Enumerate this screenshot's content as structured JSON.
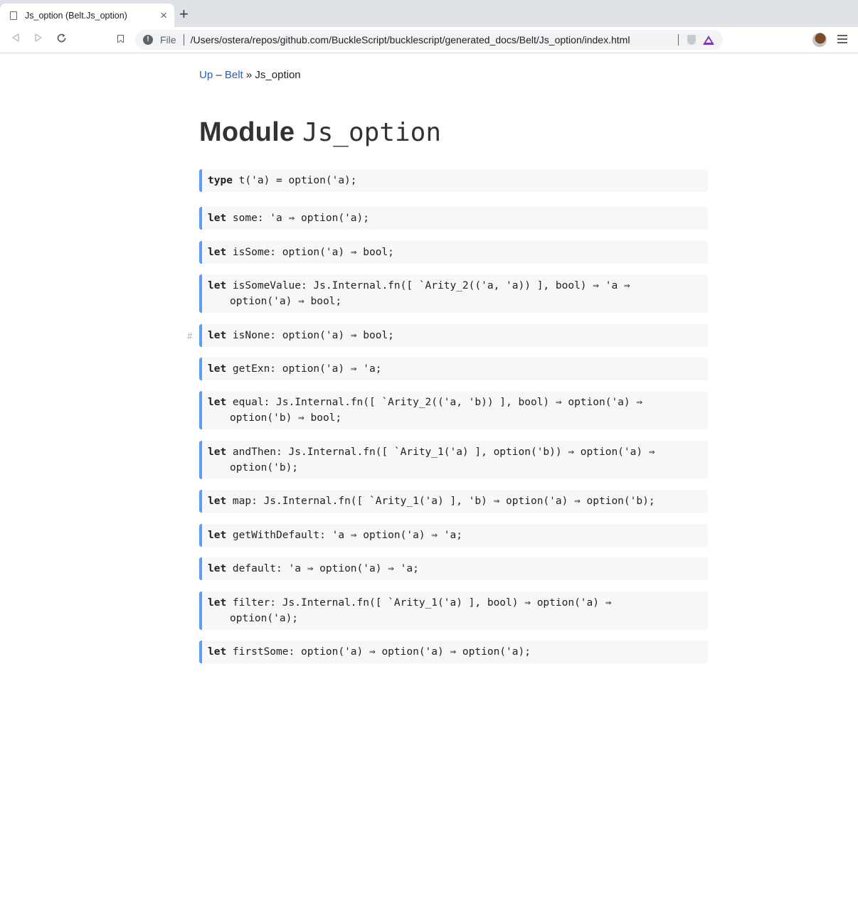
{
  "browser": {
    "tab_title": "Js_option (Belt.Js_option)",
    "tab_close": "×",
    "new_tab": "+",
    "scheme_label": "File",
    "url": "/Users/ostera/repos/github.com/BuckleScript/bucklescript/generated_docs/Belt/Js_option/index.html",
    "icons": [
      "doc-icon",
      "back-icon",
      "forward-icon",
      "reload-icon",
      "bookmark-icon",
      "info-icon",
      "shield-icon",
      "rewards-icon",
      "avatar",
      "menu-icon"
    ]
  },
  "breadcrumb": {
    "up": "Up",
    "dash": " – ",
    "belt": "Belt",
    "sep": " » ",
    "current": "Js_option"
  },
  "page": {
    "title_word": "Module ",
    "title_name": "Js_option",
    "anchor": "#"
  },
  "specs": [
    {
      "kw": "type",
      "line1": " t('a) = option('a);",
      "line2": ""
    },
    {
      "kw": "let",
      "line1": " some: 'a ⇒ option('a);",
      "line2": ""
    },
    {
      "kw": "let",
      "line1": " isSome: option('a) ⇒ bool;",
      "line2": ""
    },
    {
      "kw": "let",
      "line1": " isSomeValue: Js.Internal.fn([ `Arity_2(('a, 'a)) ], bool) ⇒ 'a ⇒",
      "line2": "option('a) ⇒ bool;"
    },
    {
      "kw": "let",
      "line1": " isNone: option('a) ⇒ bool;",
      "line2": ""
    },
    {
      "kw": "let",
      "line1": " getExn: option('a) ⇒ 'a;",
      "line2": ""
    },
    {
      "kw": "let",
      "line1": " equal: Js.Internal.fn([ `Arity_2(('a, 'b)) ], bool) ⇒ option('a) ⇒",
      "line2": "option('b) ⇒ bool;"
    },
    {
      "kw": "let",
      "line1": " andThen: Js.Internal.fn([ `Arity_1('a) ], option('b)) ⇒ option('a) ⇒",
      "line2": "option('b);"
    },
    {
      "kw": "let",
      "line1": " map: Js.Internal.fn([ `Arity_1('a) ], 'b) ⇒ option('a) ⇒ option('b);",
      "line2": ""
    },
    {
      "kw": "let",
      "line1": " getWithDefault: 'a ⇒ option('a) ⇒ 'a;",
      "line2": ""
    },
    {
      "kw": "let",
      "line1": " default: 'a ⇒ option('a) ⇒ 'a;",
      "line2": ""
    },
    {
      "kw": "let",
      "line1": " filter: Js.Internal.fn([ `Arity_1('a) ], bool) ⇒ option('a) ⇒",
      "line2": "option('a);"
    },
    {
      "kw": "let",
      "line1": " firstSome: option('a) ⇒ option('a) ⇒ option('a);",
      "line2": ""
    }
  ],
  "colors": {
    "link": "#2c5cbd",
    "spec_border": "#5c9cf5",
    "spec_bg": "#f6f7f8"
  }
}
